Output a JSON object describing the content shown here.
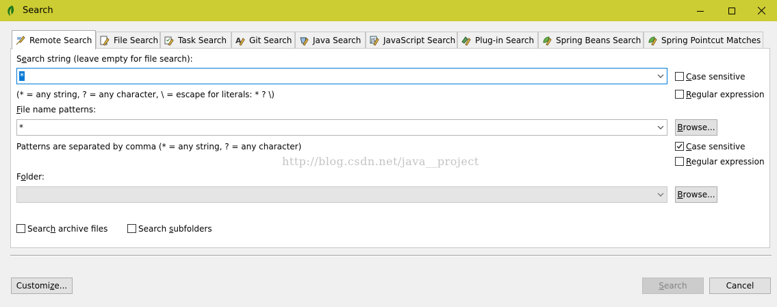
{
  "window": {
    "title": "Search"
  },
  "tabs": [
    {
      "label": "Remote Search",
      "active": true
    },
    {
      "label": "File Search"
    },
    {
      "label": "Task Search"
    },
    {
      "label": "Git Search"
    },
    {
      "label": "Java Search"
    },
    {
      "label": "JavaScript Search"
    },
    {
      "label": "Plug-in Search"
    },
    {
      "label": "Spring Beans Search"
    },
    {
      "label": "Spring Pointcut Matches"
    }
  ],
  "search_string": {
    "label_pre": "S",
    "label_u": "e",
    "label_post": "arch string (leave empty for file search):",
    "value": "*",
    "hint": "(* = any string, ? = any character, \\ = escape for literals: * ? \\)"
  },
  "options1": {
    "case_u": "C",
    "case_rest": "ase sensitive",
    "case_checked": false,
    "regex_u": "R",
    "regex_rest": "egular expression",
    "regex_checked": false
  },
  "file_patterns": {
    "label_u": "F",
    "label_rest": "ile name patterns:",
    "value": "*",
    "hint": "Patterns are separated by comma (* = any string, ? = any character)",
    "browse_u": "B",
    "browse_rest": "rowse..."
  },
  "options2": {
    "case_u": "C",
    "case_rest": "ase sensitive",
    "case_checked": true,
    "regex_u": "R",
    "regex_rest": "egular expression",
    "regex_checked": false
  },
  "watermark": "http://blog.csdn.net/java__project",
  "folder": {
    "label_pre": "F",
    "label_u": "o",
    "label_post": "lder:",
    "value": "",
    "browse_u": "B",
    "browse_rest": "rowse..."
  },
  "archive": {
    "pre": "Searc",
    "u": "h",
    "post": " archive files",
    "checked": false
  },
  "subfolders": {
    "pre": "Search ",
    "u": "s",
    "post": "ubfolders",
    "checked": false
  },
  "footer": {
    "customize_pre": "Customi",
    "customize_u": "z",
    "customize_post": "e...",
    "search_u": "S",
    "search_rest": "earch",
    "cancel": "Cancel"
  }
}
